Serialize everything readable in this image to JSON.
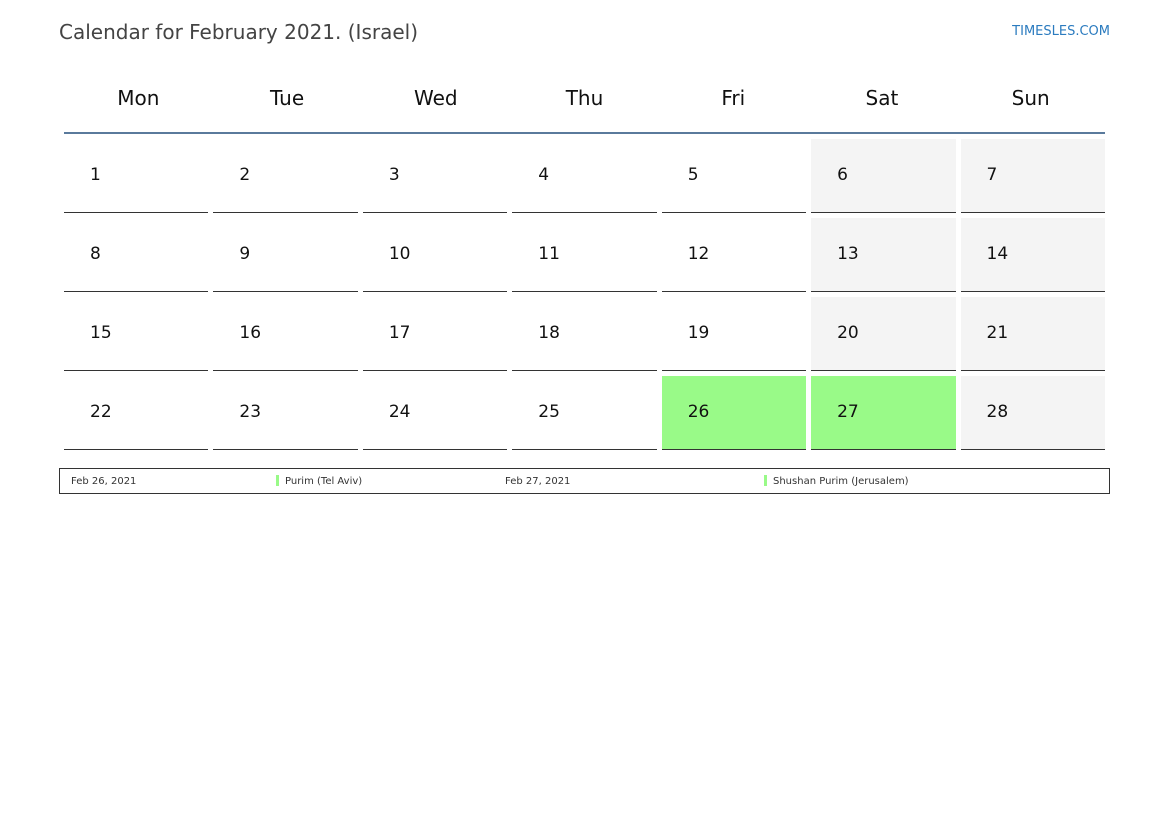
{
  "header": {
    "title": "Calendar for February 2021. (Israel)",
    "site_link": "TIMESLES.COM"
  },
  "colors": {
    "header_rule": "#5a7a9c",
    "weekend_bg": "#f4f4f4",
    "holiday_bg": "#99fa88",
    "link": "#2b7bbf"
  },
  "calendar": {
    "weekdays": [
      "Mon",
      "Tue",
      "Wed",
      "Thu",
      "Fri",
      "Sat",
      "Sun"
    ],
    "weeks": [
      [
        "1",
        "2",
        "3",
        "4",
        "5",
        "6",
        "7"
      ],
      [
        "8",
        "9",
        "10",
        "11",
        "12",
        "13",
        "14"
      ],
      [
        "15",
        "16",
        "17",
        "18",
        "19",
        "20",
        "21"
      ],
      [
        "22",
        "23",
        "24",
        "25",
        "26",
        "27",
        "28"
      ]
    ]
  },
  "legend": [
    {
      "date": "Feb 26, 2021",
      "event": "Purim (Tel Aviv)"
    },
    {
      "date": "Feb 27, 2021",
      "event": "Shushan Purim (Jerusalem)"
    }
  ]
}
